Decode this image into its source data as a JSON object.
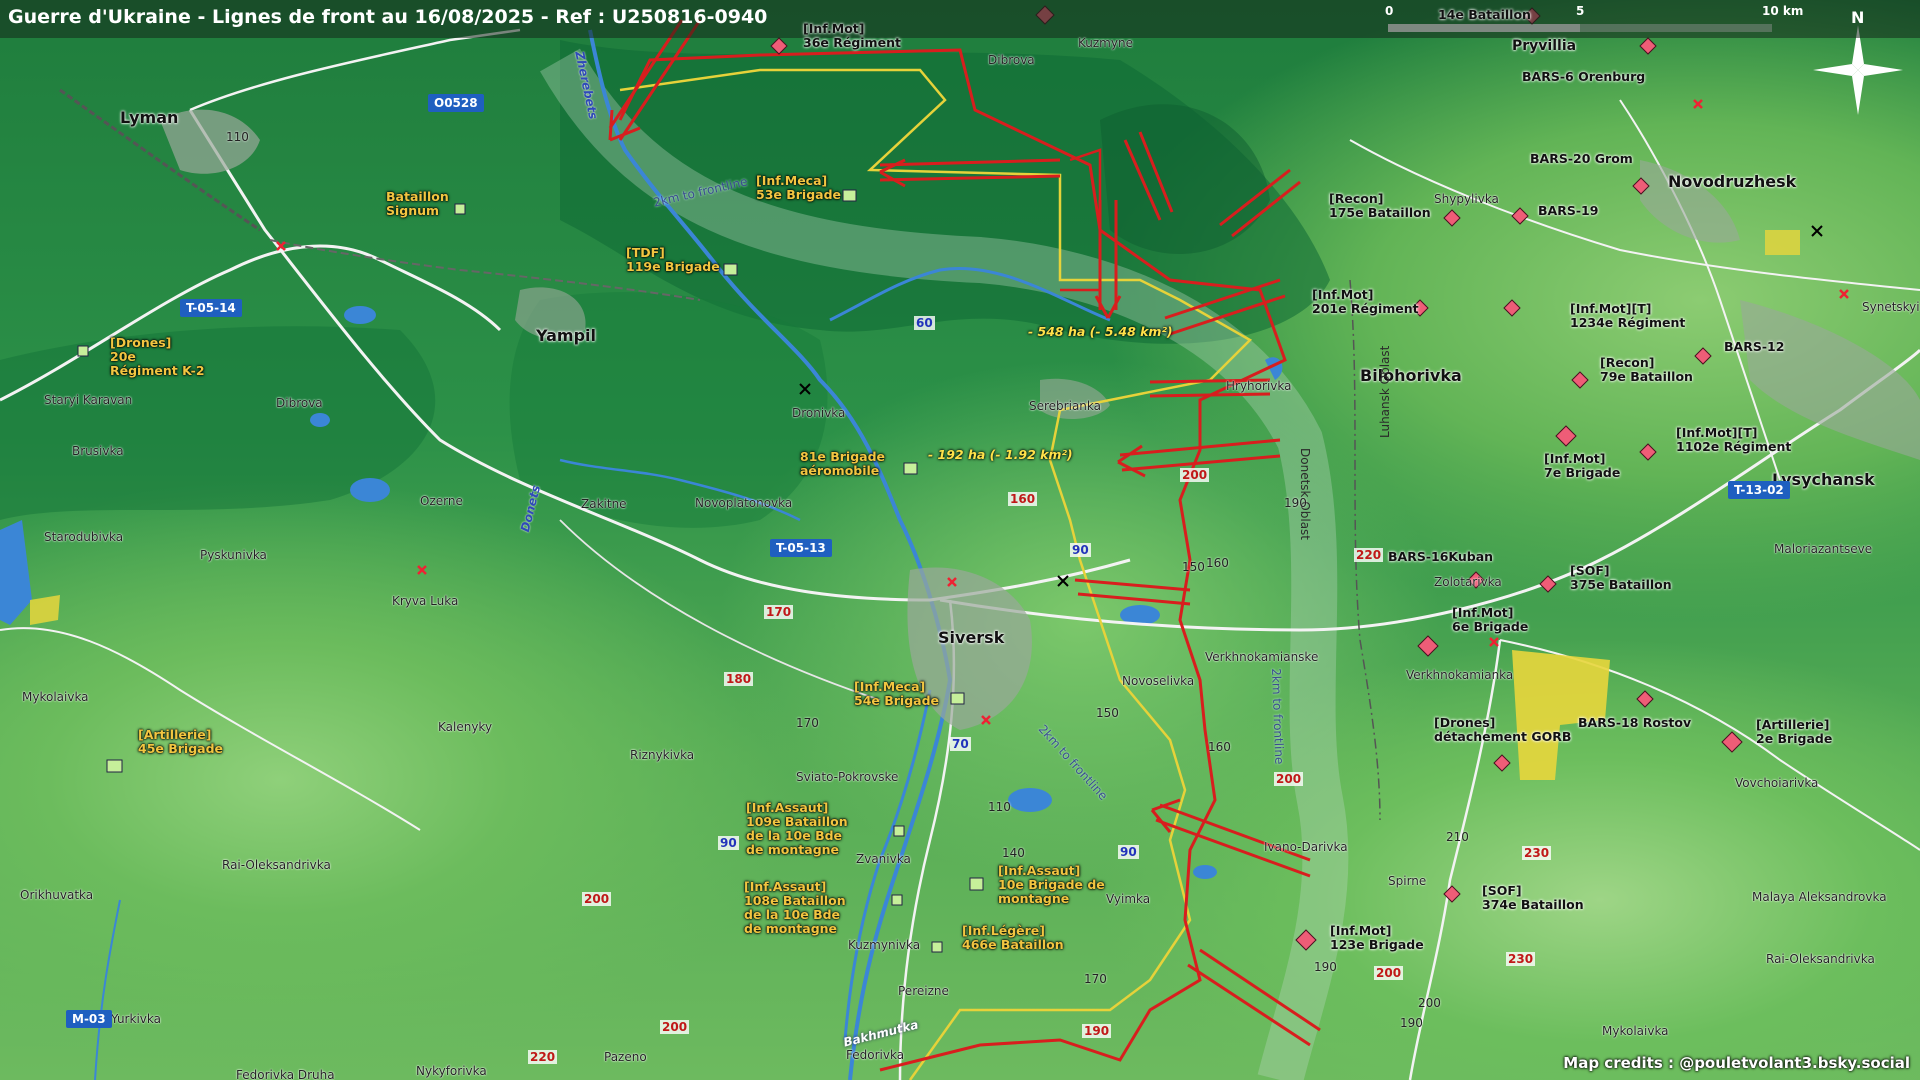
{
  "title": "Guerre d'Ukraine - Lignes de front au 16/08/2025 - Ref : U250816-0940",
  "credit": "Map credits : @pouletvolant3.bsky.social",
  "scale": {
    "labels": [
      "0",
      "5",
      "10 km"
    ]
  },
  "compass": {
    "label": "N"
  },
  "colors": {
    "front_red": "#d81e1e",
    "yellow_line": "#e6d23a",
    "ukraine_unit": "#f2c641",
    "russia_unit": "#ee5d77",
    "water": "#3b86d6"
  },
  "towns": {
    "lyman": "Lyman",
    "yampil": "Yampil",
    "siversk": "Siversk",
    "bilohorivka": "Bilohorivka",
    "lysychansk": "Lysychansk",
    "novodruzhesk": "Novodruzhesk",
    "pryvillia": "Pryvillia"
  },
  "villages": {
    "dibrova_n": "Dibrova",
    "kuzmyne": "Kuzmyne",
    "dibrova_w": "Dibrova",
    "staryi_karavan": "Staryi Karavan",
    "brusivka": "Brusivka",
    "ozerne": "Ozerne",
    "zakitne": "Zakitne",
    "novoplatonovka": "Novoplatonovka",
    "dronivka": "Dronivka",
    "serebrianka": "Serebrianka",
    "hryhorivka": "Hryhorivka",
    "shypylivka": "Shypylivka",
    "synetskyi": "Synetskyi",
    "starodubivka": "Starodubivka",
    "pyskunivka": "Pyskunivka",
    "kryva_luka": "Kryva Luka",
    "mykolaivka_w": "Mykolaivka",
    "kalenyky": "Kalenyky",
    "riznykivka": "Riznykivka",
    "sviato_pokrovske": "Sviato-Pokrovske",
    "novoselivka": "Novoselivka",
    "verkhnokamianske": "Verkhnokamianske",
    "zolotarivka": "Zolotarivka",
    "verkhnokamianka": "Verkhnokamianka",
    "maloriazantseve": "Maloriazantseve",
    "vovchoiarivka": "Vovchoiarivka",
    "rai_oleksandrivka_w": "Rai-Oleksandrivka",
    "orikhuvatka": "Orikhuvatka",
    "zvanivka": "Zvanivka",
    "vyimka": "Vyimka",
    "ivano_darivka": "Ivano-Darivka",
    "spirne": "Spirne",
    "malaya_aleksandrovka": "Malaya Aleksandrovka",
    "rai_oleksandrivka_e": "Rai-Oleksandrivka",
    "kuzmynivka": "Kuzmynivka",
    "pereizne": "Pereizne",
    "yurkivka": "Yurkivka",
    "pazeno": "Pazeno",
    "fedorivka": "Fedorivka",
    "fedorivka_druha": "Fedorivka Druha",
    "nykyforivka": "Nykyforivka",
    "mykolaivka_e": "Mykolaivka"
  },
  "roads": {
    "o0528": "O0528",
    "t0514": "T-05-14",
    "t0513": "T-05-13",
    "t1302": "T-13-02",
    "m03": "M-03"
  },
  "units_ua": {
    "signum": "Bataillon\nSignum",
    "b53": "[Inf.Meca]\n53e Brigade",
    "b119": "[TDF]\n119e Brigade",
    "k2": "[Drones]\n20e\nRégiment K-2",
    "b81": "81e Brigade\naéromobile",
    "b45": "[Artillerie]\n45e Brigade",
    "b54": "[Inf.Meca]\n54e Brigade",
    "b109": "[Inf.Assaut]\n109e Bataillon\nde la 10e Bde\nde montagne",
    "b108": "[Inf.Assaut]\n108e Bataillon\nde la 10e Bde\nde montagne",
    "b10": "[Inf.Assaut]\n10e Brigade de\nmontagne",
    "b466": "[Inf.Légère]\n466e Bataillon"
  },
  "units_ru": {
    "r36": "[Inf.Mot]\n36e Régiment",
    "b14": "14e Bataillon",
    "bars6": "BARS-6 Orenburg",
    "bars20": "BARS-20 Grom",
    "b175": "[Recon]\n175e Bataillon",
    "bars19": "BARS-19",
    "r201": "[Inf.Mot]\n201e Régiment",
    "r1234": "[Inf.Mot][T]\n1234e Régiment",
    "bars12": "BARS-12",
    "b79": "[Recon]\n79e Bataillon",
    "b7": "[Inf.Mot]\n7e Brigade",
    "r1102": "[Inf.Mot][T]\n1102e Régiment",
    "bars16": "BARS-16Kuban",
    "b375": "[SOF]\n375e Bataillon",
    "b6": "[Inf.Mot]\n6e Brigade",
    "gorb": "[Drones]\ndétachement GORB",
    "bars18": "BARS-18 Rostov",
    "b2art": "[Artillerie]\n2e Brigade",
    "b374": "[SOF]\n374e Bataillon",
    "b123": "[Inf.Mot]\n123e Brigade"
  },
  "areas": {
    "a548": "- 548 ha (- 5.48 km²)",
    "a192": "- 192 ha (- 1.92 km²)"
  },
  "rivers": {
    "zherebets": "Zherebets",
    "donets": "Donets",
    "bakhmutka": "Bakhmutka"
  },
  "buffers": {
    "north": "2km to frontline",
    "south": "2km to frontline",
    "east": "2km to frontline"
  },
  "oblasts": {
    "donetsk": "Donetsk Oblast",
    "luhansk": "Luhansk Oblast"
  },
  "elevations": {
    "e110": "110",
    "e60": "60",
    "e160": "160",
    "e200a": "200",
    "e190": "190",
    "e90a": "90",
    "e150a": "150",
    "e160b": "160",
    "e220": "220",
    "e170a": "170",
    "e180": "180",
    "e170b": "170",
    "e70": "70",
    "e150b": "150",
    "e160c": "160",
    "e200b": "200",
    "e90b": "90",
    "e110b": "110",
    "e140": "140",
    "e90c": "90",
    "e210": "210",
    "e230a": "230",
    "e200c": "200",
    "e200d": "200",
    "e170c": "170",
    "e190b": "190",
    "e230b": "230",
    "e190c": "190",
    "e200e": "200",
    "e190d": "190",
    "e220b": "220",
    "e200f": "200"
  }
}
